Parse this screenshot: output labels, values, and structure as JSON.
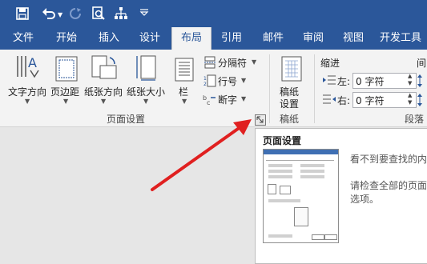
{
  "qat": {
    "save_icon": "save-icon",
    "undo_icon": "undo-icon",
    "redo_icon": "redo-icon",
    "print_preview_icon": "print-preview-icon",
    "hierarchy_icon": "hierarchy-icon",
    "customize_icon": "customize-dropdown-icon"
  },
  "tabs": [
    "文件",
    "开始",
    "插入",
    "设计",
    "布局",
    "引用",
    "邮件",
    "审阅",
    "视图",
    "开发工具"
  ],
  "active_tab": "布局",
  "ribbon": {
    "text_direction": "文字方向",
    "margins": "页边距",
    "orientation": "纸张方向",
    "size": "纸张大小",
    "columns": "栏",
    "breaks": "分隔符",
    "line_numbers": "行号",
    "hyphenation": "断字",
    "page_setup_group": "页面设置",
    "manuscript_line1": "稿纸",
    "manuscript_line2": "设置",
    "manuscript_group": "稿纸",
    "indent_title": "缩进",
    "indent_left_label": "左:",
    "indent_left_value": "0 字符",
    "indent_right_label": "右:",
    "indent_right_value": "0 字符",
    "spacing_title_partial": "间",
    "paragraph_group": "段落"
  },
  "tooltip": {
    "title": "页面设置",
    "line1": "看不到要查找的内",
    "line2": "请检查全部的页面",
    "line3": "选项。"
  },
  "colors": {
    "brand": "#2b579a",
    "arrow": "#e02020"
  }
}
